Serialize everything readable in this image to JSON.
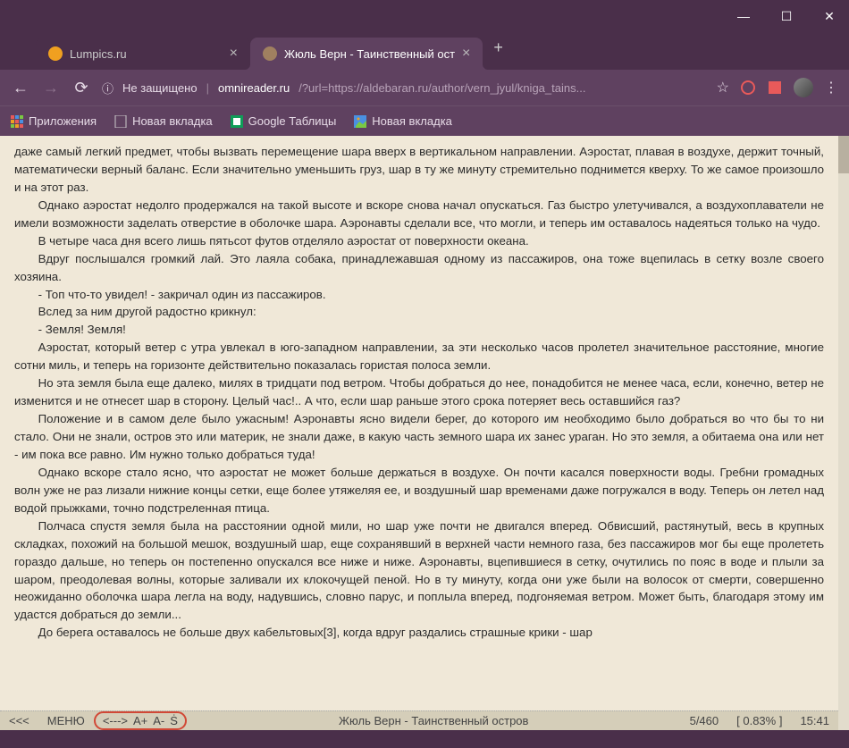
{
  "window": {
    "minimize": "—",
    "maximize": "☐",
    "close": "✕"
  },
  "tabs": [
    {
      "title": "Lumpics.ru",
      "icon_color": "#f0a020"
    },
    {
      "title": "Жюль Верн - Таинственный ост",
      "icon_color": "#a08060"
    }
  ],
  "add_tab": "+",
  "nav": {
    "back": "←",
    "forward": "→",
    "reload": "⟳",
    "info": "ⓘ",
    "not_secure": "Не защищено",
    "domain": "omnireader.ru",
    "path": "/?url=https://aldebaran.ru/author/vern_jyul/kniga_tains...",
    "star": "☆",
    "menu": "⋮"
  },
  "bookmarks": [
    {
      "label": "Приложения",
      "icon": "apps"
    },
    {
      "label": "Новая вкладка",
      "icon": "page"
    },
    {
      "label": "Google Таблицы",
      "icon": "sheets"
    },
    {
      "label": "Новая вкладка",
      "icon": "img"
    }
  ],
  "body_paragraphs": [
    "даже самый легкий предмет, чтобы вызвать перемещение шара вверх в вертикальном направлении. Аэростат, плавая в воздухе, держит точный, математически верный баланс. Если значительно уменьшить груз, шар в ту же минуту стремительно поднимется кверху. То же самое произошло и на этот раз.",
    "Однако аэростат недолго продержался на такой высоте и вскоре снова начал опускаться. Газ быстро улетучивался, а воздухоплаватели не имели возможности заделать отверстие в оболочке шара. Аэронавты сделали все, что могли, и теперь им оставалось надеяться только на чудо.",
    "В четыре часа дня всего лишь пятьсот футов отделяло аэростат от поверхности океана.",
    "Вдруг послышался громкий лай. Это лаяла собака, принадлежавшая одному из пассажиров, она тоже вцепилась в сетку возле своего хозяина.",
    "- Топ что-то увидел! - закричал один из пассажиров.",
    "Вслед за ним другой радостно крикнул:",
    "- Земля! Земля!",
    "Аэростат, который ветер с утра увлекал в юго-западном направлении, за эти несколько часов пролетел значительное расстояние, многие сотни миль, и теперь на горизонте действительно показалась гористая полоса земли.",
    "Но эта земля была еще далеко, милях в тридцати под ветром. Чтобы добраться до нее, понадобится не менее часа, если, конечно, ветер не изменится и не отнесет шар в сторону. Целый час!.. А что, если шар раньше этого срока потеряет весь оставшийся газ?",
    "Положение и в самом деле было ужасным! Аэронавты ясно видели берег, до которого им необходимо было добраться во что бы то ни стало. Они не знали, остров это или материк, не знали даже, в какую часть земного шара их занес ураган. Но это земля, а обитаема она или нет - им пока все равно. Им нужно только добраться туда!",
    "Однако вскоре стало ясно, что аэростат не может больше держаться в воздухе. Он почти касался поверхности воды. Гребни громадных волн уже не раз лизали нижние концы сетки, еще более утяжеляя ее, и воздушный шар временами даже погружался в воду. Теперь он летел над водой прыжками, точно подстреленная птица.",
    "Полчаса спустя земля была на расстоянии одной мили, но шар уже почти не двигался вперед. Обвисший, растянутый, весь в крупных складках, похожий на большой мешок, воздушный шар, еще сохранявший в верхней части немного газа, без пассажиров мог бы еще пролететь гораздо дальше, но теперь он постепенно опускался все ниже и ниже. Аэронавты, вцепившиеся в сетку, очутились по пояс в воде и плыли за шаром, преодолевая волны, которые заливали их клокочущей пеной. Но в ту минуту, когда они уже были на волосок от смерти, совершенно неожиданно оболочка шара легла на воду, надувшись, словно парус, и поплыла вперед, подгоняемая ветром. Может быть, благодаря этому им удастся добраться до земли...",
    "До берега оставалось не больше двух кабельтовых[3], когда вдруг раздались страшные крики - шар"
  ],
  "reader_bar": {
    "prev": "<<<",
    "menu": "МЕНЮ",
    "width": "<--->",
    "font_plus": "A+",
    "font_minus": "A-",
    "settings": "Ṡ",
    "book_title": "Жюль Верн - Таинственный остров",
    "page": "5/460",
    "percent": "[ 0.83% ]",
    "time": "15:41"
  }
}
